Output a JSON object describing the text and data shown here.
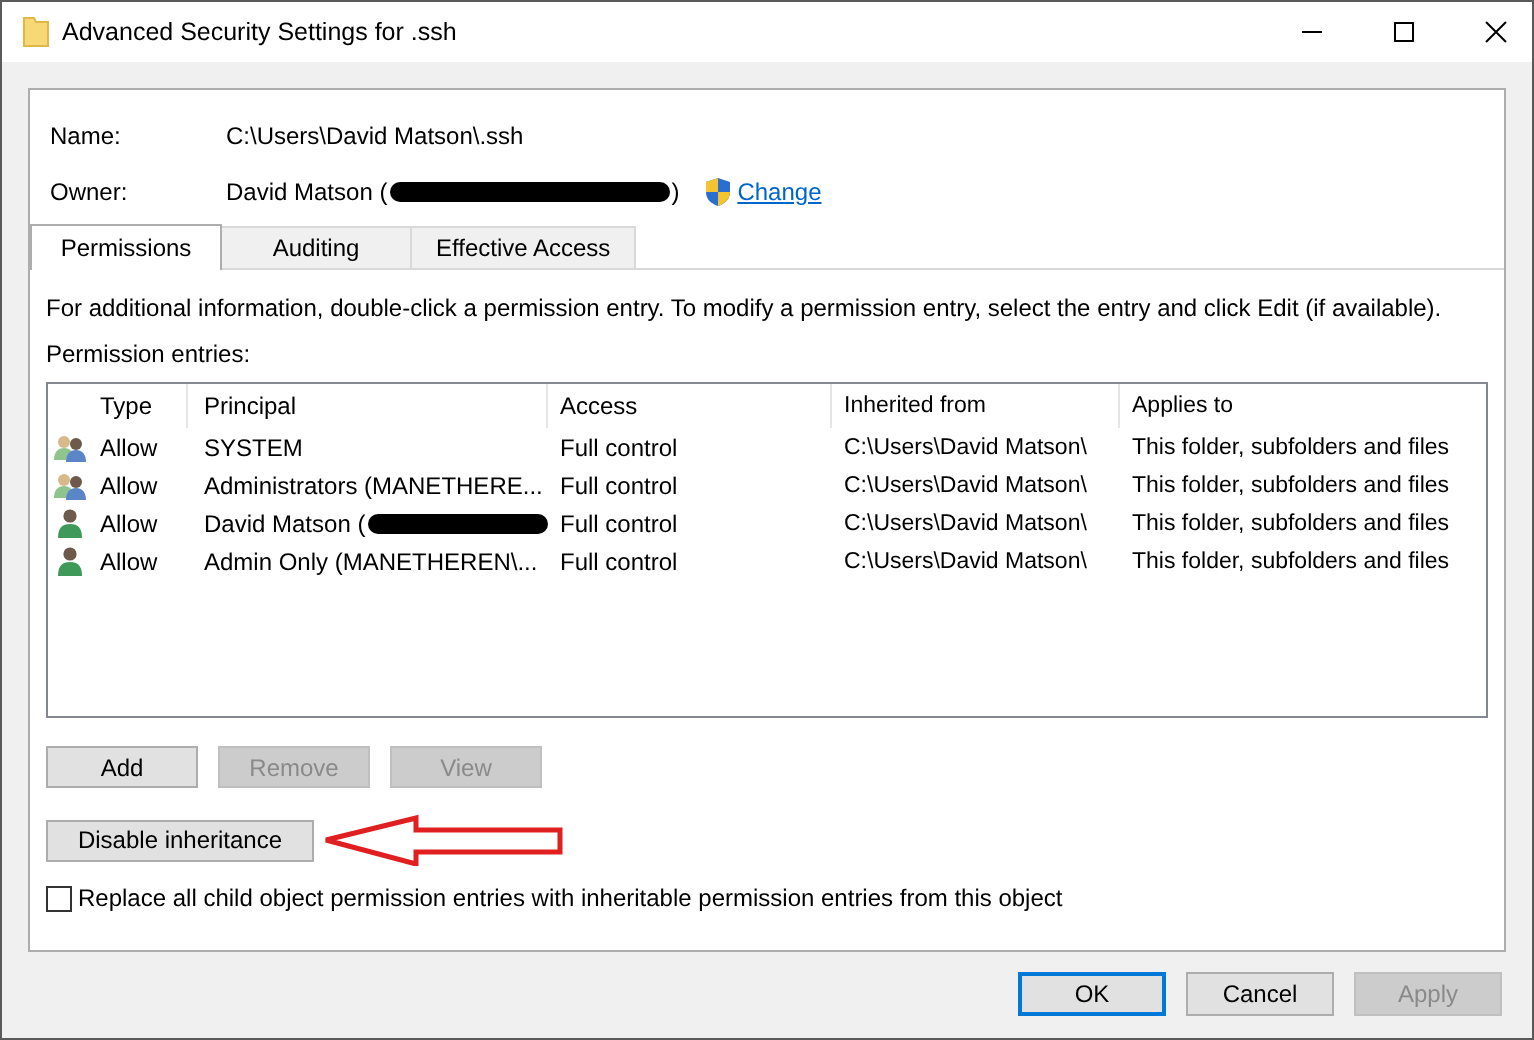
{
  "window": {
    "title": "Advanced Security Settings for .ssh"
  },
  "name": {
    "label": "Name:",
    "value": "C:\\Users\\David Matson\\.ssh"
  },
  "owner": {
    "label": "Owner:",
    "value": "David Matson (",
    "redacted": true,
    "value_end": ")",
    "change_link": "Change"
  },
  "tabs": [
    {
      "label": "Permissions",
      "selected": true
    },
    {
      "label": "Auditing",
      "selected": false
    },
    {
      "label": "Effective Access",
      "selected": false
    }
  ],
  "info_text": "For additional information, double-click a permission entry. To modify a permission entry, select the entry and click Edit (if available).",
  "entries_label": "Permission entries:",
  "table": {
    "columns": [
      "Type",
      "Principal",
      "Access",
      "Inherited from",
      "Applies to"
    ],
    "rows": [
      {
        "kind": "group",
        "type": "Allow",
        "principal": "SYSTEM",
        "redacted": false,
        "access": "Full control",
        "inherited_from": "C:\\Users\\David Matson\\",
        "applies_to": "This folder, subfolders and files"
      },
      {
        "kind": "group",
        "type": "Allow",
        "principal": "Administrators (MANETHERE...",
        "redacted": false,
        "access": "Full control",
        "inherited_from": "C:\\Users\\David Matson\\",
        "applies_to": "This folder, subfolders and files"
      },
      {
        "kind": "user",
        "type": "Allow",
        "principal": "David Matson (",
        "redacted": true,
        "access": "Full control",
        "inherited_from": "C:\\Users\\David Matson\\",
        "applies_to": "This folder, subfolders and files"
      },
      {
        "kind": "user",
        "type": "Allow",
        "principal": "Admin Only (MANETHEREN\\...",
        "redacted": false,
        "access": "Full control",
        "inherited_from": "C:\\Users\\David Matson\\",
        "applies_to": "This folder, subfolders and files"
      }
    ]
  },
  "entry_buttons": [
    {
      "label": "Add",
      "disabled": false
    },
    {
      "label": "Remove",
      "disabled": true
    },
    {
      "label": "View",
      "disabled": true
    }
  ],
  "inheritance_button": "Disable inheritance",
  "replace_checkbox": {
    "label": "Replace all child object permission entries with inheritable permission entries from this object",
    "checked": false
  },
  "footer_buttons": [
    {
      "label": "OK",
      "disabled": false,
      "selected": true
    },
    {
      "label": "Cancel",
      "disabled": false,
      "selected": false
    },
    {
      "label": "Apply",
      "disabled": true,
      "selected": false
    }
  ]
}
